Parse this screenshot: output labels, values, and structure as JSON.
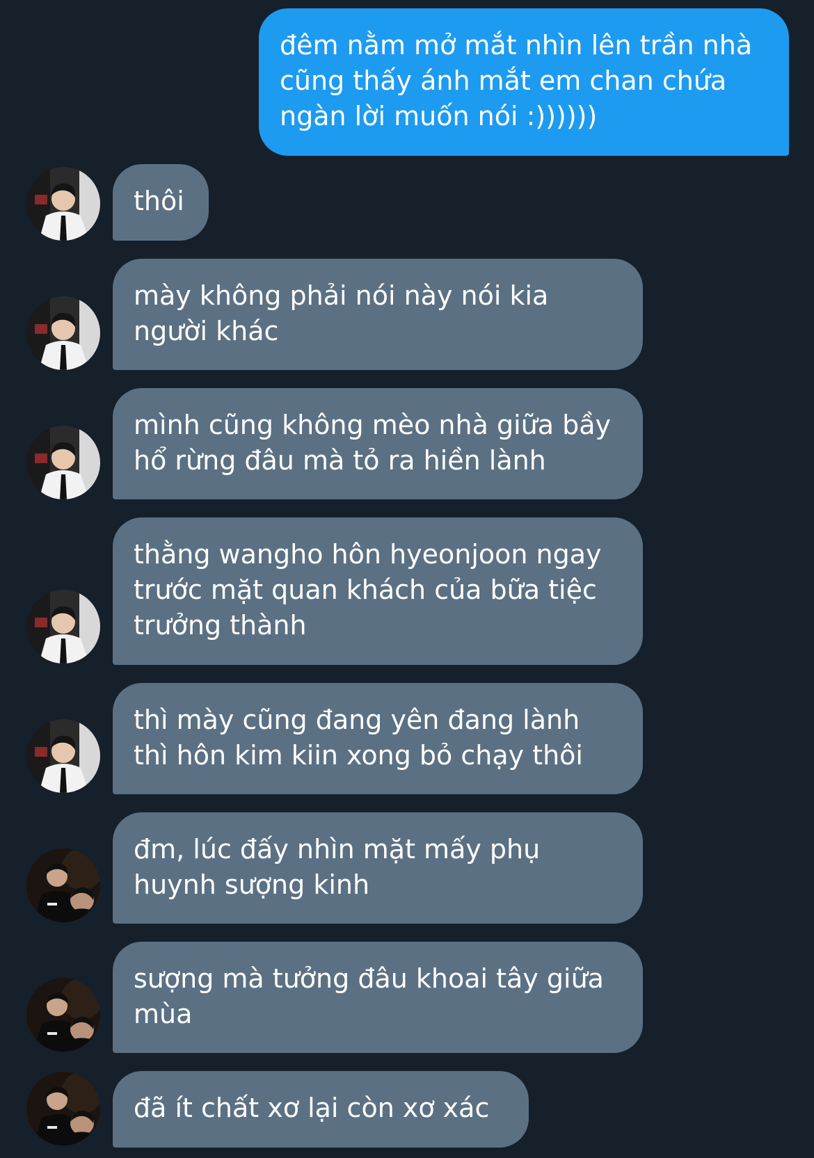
{
  "thread": {
    "messages": [
      {
        "direction": "outgoing",
        "text": "đêm nằm mở mắt nhìn lên trần nhà\ncũng thấy ánh mắt em chan chứa\nngàn lời muốn nói :))))))"
      },
      {
        "direction": "incoming",
        "avatar": "avatar-white-shirt",
        "text": "thôi"
      },
      {
        "direction": "incoming",
        "avatar": "avatar-white-shirt",
        "text": "mày không phải nói này nói kia\nngười khác"
      },
      {
        "direction": "incoming",
        "avatar": "avatar-white-shirt",
        "text": "mình cũng không mèo nhà giữa bầy\nhổ rừng đâu mà tỏ ra hiền lành"
      },
      {
        "direction": "incoming",
        "avatar": "avatar-white-shirt",
        "text": "thằng wangho hôn hyeonjoon ngay\ntrước mặt quan khách của bữa tiệc\ntrưởng thành"
      },
      {
        "direction": "incoming",
        "avatar": "avatar-white-shirt",
        "text": "thì mày cũng đang yên đang lành\nthì hôn kim kiin xong bỏ chạy thôi"
      },
      {
        "direction": "incoming",
        "avatar": "avatar-dark-jacket",
        "text": "đm, lúc đấy nhìn mặt mấy phụ\nhuynh sượng kinh"
      },
      {
        "direction": "incoming",
        "avatar": "avatar-dark-jacket",
        "text": "sượng mà tưởng đâu khoai tây giữa\nmùa"
      },
      {
        "direction": "incoming",
        "avatar": "avatar-dark-jacket",
        "text": "đã ít chất xơ lại còn xơ xác"
      }
    ]
  },
  "colors": {
    "background": "#15202b",
    "outgoing_bubble": "#1d9bf0",
    "incoming_bubble": "#5b7083",
    "text": "#ffffff"
  }
}
